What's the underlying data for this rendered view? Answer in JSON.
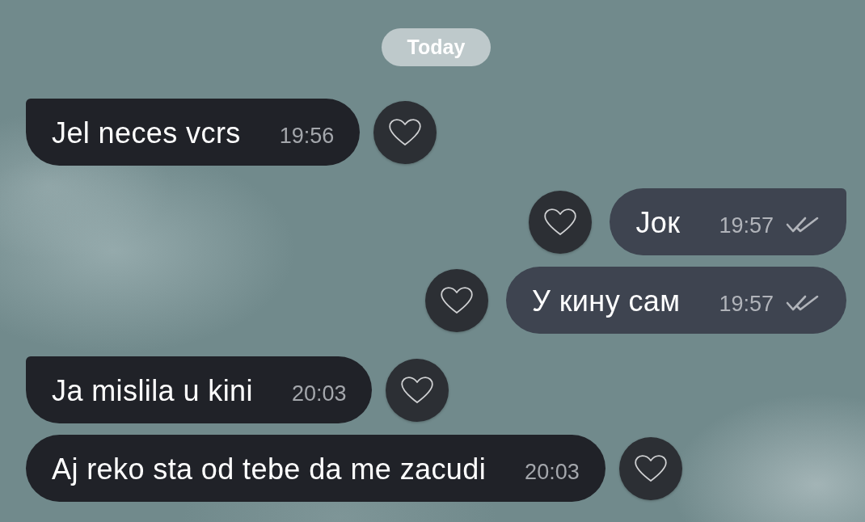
{
  "date_divider": {
    "label": "Today"
  },
  "messages": [
    {
      "kind": "incoming",
      "text": "Jel neces vcrs",
      "time": "19:56",
      "liked": false
    },
    {
      "kind": "outgoing",
      "text": "Јок",
      "time": "19:57",
      "read": true,
      "liked": false
    },
    {
      "kind": "outgoing",
      "text": "У кину сам",
      "time": "19:57",
      "read": true,
      "liked": false
    },
    {
      "kind": "incoming",
      "text": "Ja mislila u kini",
      "time": "20:03",
      "liked": false
    },
    {
      "kind": "incoming",
      "text": "Aj reko sta od tebe da me zacudi",
      "time": "20:03",
      "liked": false
    }
  ]
}
